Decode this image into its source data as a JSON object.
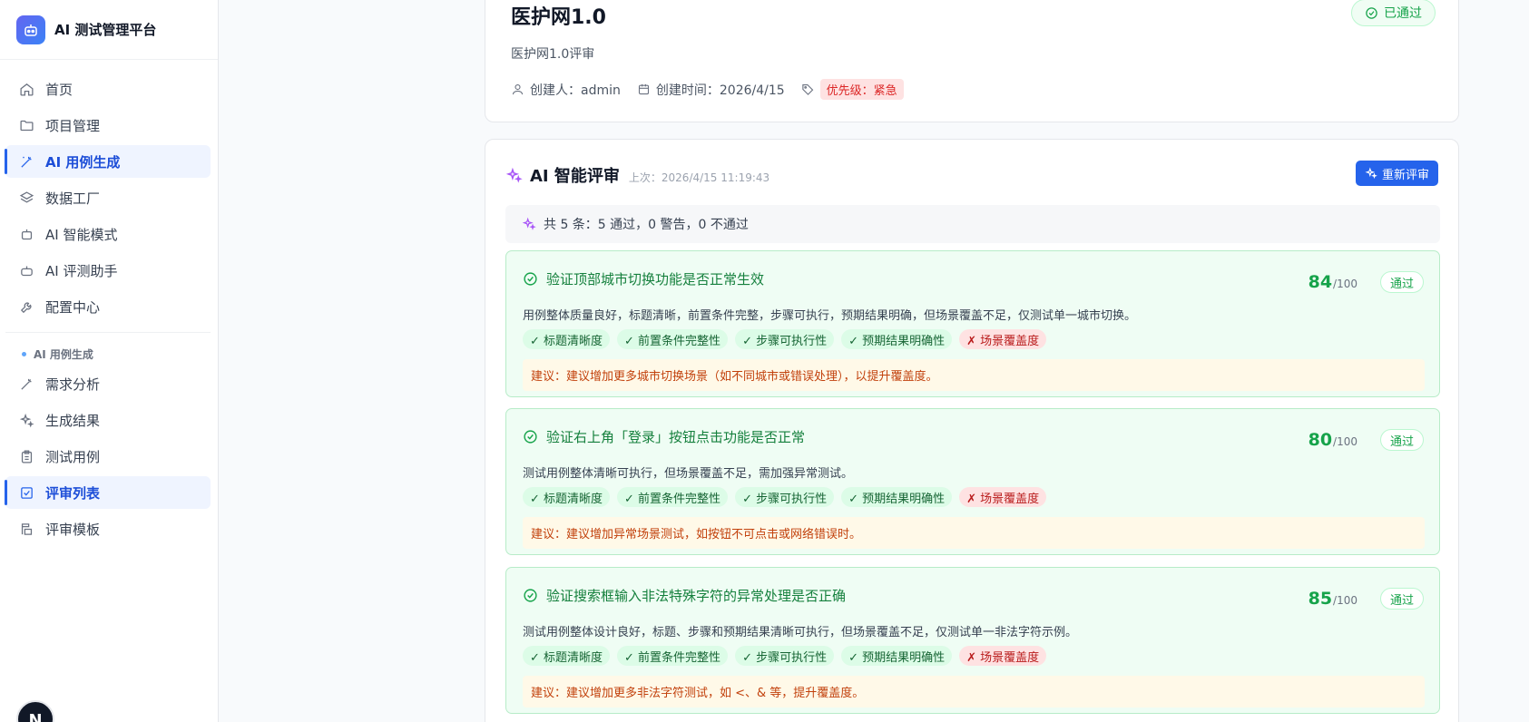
{
  "sidebar": {
    "brand": "AI 测试管理平台",
    "items": [
      {
        "label": "首页",
        "icon": "home-icon",
        "active": false
      },
      {
        "label": "项目管理",
        "icon": "folder-icon",
        "active": false
      },
      {
        "label": "AI 用例生成",
        "icon": "magic-wand-icon",
        "active": true
      },
      {
        "label": "数据工厂",
        "icon": "layers-icon",
        "active": false
      },
      {
        "label": "AI 智能模式",
        "icon": "robot-icon",
        "active": false
      },
      {
        "label": "AI 评测助手",
        "icon": "bot-icon",
        "active": false
      },
      {
        "label": "配置中心",
        "icon": "wrench-icon",
        "active": false
      }
    ],
    "section_title": "AI 用例生成",
    "sub_items": [
      {
        "label": "需求分析",
        "icon": "magic-wand-icon",
        "active": false
      },
      {
        "label": "生成结果",
        "icon": "sparkles-icon",
        "active": false
      },
      {
        "label": "测试用例",
        "icon": "clipboard-icon",
        "active": false
      },
      {
        "label": "评审列表",
        "icon": "check-square-icon",
        "active": true
      },
      {
        "label": "评审模板",
        "icon": "template-icon",
        "active": false
      }
    ],
    "avatar_initial": "N"
  },
  "requirement": {
    "title": "医护网1.0",
    "status": "已通过",
    "description": "医护网1.0评审",
    "creator_label": "创建人：admin",
    "created_label": "创建时间：2026/4/15",
    "priority_label": "优先级：紧急"
  },
  "review": {
    "title": "AI 智能评审",
    "last_run": "上次：2026/4/15 11:19:43",
    "rerun_label": "重新评审",
    "summary": "共 5 条：5 通过，0 警告，0 不通过",
    "cases": [
      {
        "title": "验证顶部城市切换功能是否正常生效",
        "score": "84",
        "max": "/100",
        "status": "通过",
        "description": "用例整体质量良好，标题清晰，前置条件完整，步骤可执行，预期结果明确，但场景覆盖不足，仅测试单一城市切换。",
        "tags": [
          {
            "label": "✓ 标题清晰度",
            "ok": true
          },
          {
            "label": "✓ 前置条件完整性",
            "ok": true
          },
          {
            "label": "✓ 步骤可执行性",
            "ok": true
          },
          {
            "label": "✓ 预期结果明确性",
            "ok": true
          },
          {
            "label": "✗ 场景覆盖度",
            "ok": false
          }
        ],
        "suggestion": "建议：建议增加更多城市切换场景（如不同城市或错误处理），以提升覆盖度。"
      },
      {
        "title": "验证右上角「登录」按钮点击功能是否正常",
        "score": "80",
        "max": "/100",
        "status": "通过",
        "description": "测试用例整体清晰可执行，但场景覆盖不足，需加强异常测试。",
        "tags": [
          {
            "label": "✓ 标题清晰度",
            "ok": true
          },
          {
            "label": "✓ 前置条件完整性",
            "ok": true
          },
          {
            "label": "✓ 步骤可执行性",
            "ok": true
          },
          {
            "label": "✓ 预期结果明确性",
            "ok": true
          },
          {
            "label": "✗ 场景覆盖度",
            "ok": false
          }
        ],
        "suggestion": "建议：建议增加异常场景测试，如按钮不可点击或网络错误时。"
      },
      {
        "title": "验证搜索框输入非法特殊字符的异常处理是否正确",
        "score": "85",
        "max": "/100",
        "status": "通过",
        "description": "测试用例整体设计良好，标题、步骤和预期结果清晰可执行，但场景覆盖不足，仅测试单一非法字符示例。",
        "tags": [
          {
            "label": "✓ 标题清晰度",
            "ok": true
          },
          {
            "label": "✓ 前置条件完整性",
            "ok": true
          },
          {
            "label": "✓ 步骤可执行性",
            "ok": true
          },
          {
            "label": "✓ 预期结果明确性",
            "ok": true
          },
          {
            "label": "✗ 场景覆盖度",
            "ok": false
          }
        ],
        "suggestion": "建议：建议增加更多非法字符测试，如 <、& 等，提升覆盖度。"
      }
    ]
  },
  "colors": {
    "accent": "#2563eb",
    "pass": "#16a34a",
    "danger": "#dc2626",
    "warning": "#c2410c"
  }
}
